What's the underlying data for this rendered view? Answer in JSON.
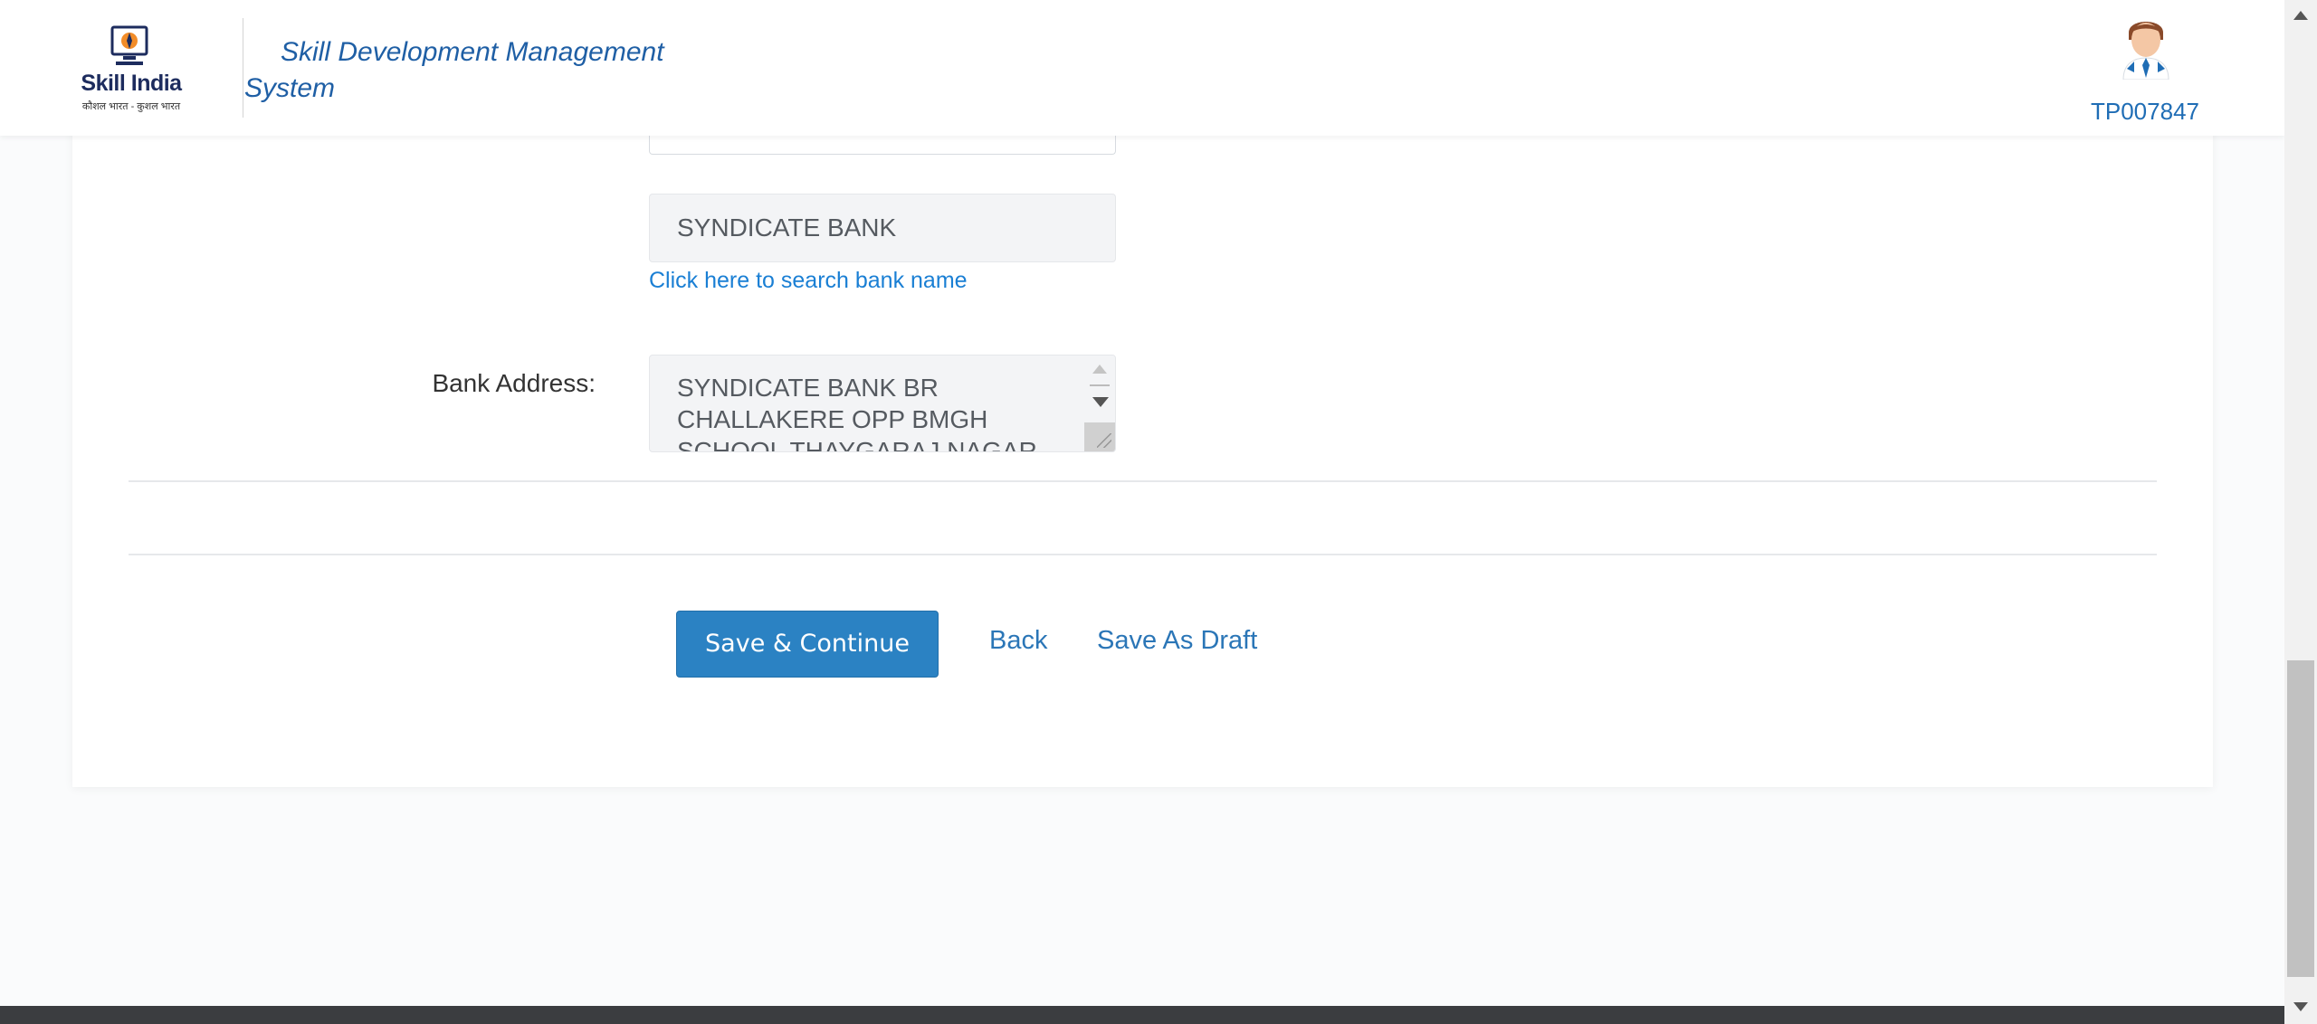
{
  "header": {
    "logo_text": "Skill India",
    "logo_tagline": "कौशल भारत - कुशल भारत",
    "app_title": "Skill Development Management System",
    "user_id": "TP007847"
  },
  "form": {
    "bank_name_value": "SYNDICATE BANK",
    "search_bank_link": "Click here to search bank name",
    "bank_address_label": "Bank Address:",
    "bank_address_value": "SYNDICATE BANK BR CHALLAKERE OPP BMGH SCHOOL THAYGARAJ NAGAR"
  },
  "actions": {
    "save_continue_label": "Save & Continue",
    "back_label": "Back",
    "save_draft_label": "Save As Draft"
  },
  "colors": {
    "primary_button": "#2b82c3",
    "link": "#1a7fd4",
    "title": "#1f5fa5"
  }
}
